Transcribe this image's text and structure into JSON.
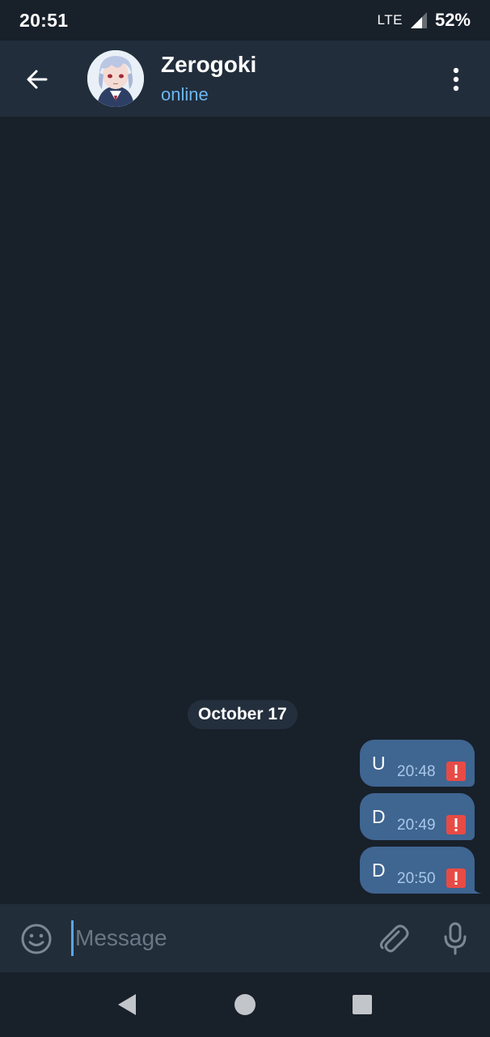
{
  "status_bar": {
    "time": "20:51",
    "network": "LTE",
    "battery": "52%"
  },
  "header": {
    "name": "Zerogoki",
    "status": "online"
  },
  "chat": {
    "date": "October 17",
    "messages": [
      {
        "text": "U",
        "time": "20:48"
      },
      {
        "text": "D",
        "time": "20:49"
      },
      {
        "text": "D",
        "time": "20:50"
      }
    ]
  },
  "composer": {
    "placeholder": "Message",
    "value": ""
  },
  "colors": {
    "accent": "#6cb5f0",
    "bubble": "#3f6591",
    "error": "#e84b45",
    "background": "#18202a",
    "header": "#212d3b"
  }
}
